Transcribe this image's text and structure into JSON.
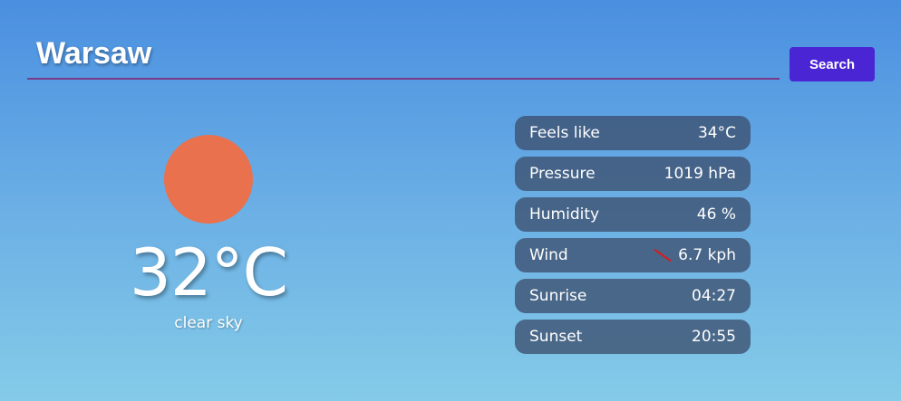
{
  "search": {
    "value": "Warsaw",
    "button_label": "Search"
  },
  "current": {
    "temperature": "32°C",
    "description": "clear sky",
    "icon": "sun-icon",
    "icon_color": "#ea714d"
  },
  "details": {
    "feels_like": {
      "label": "Feels like",
      "value": "34°C"
    },
    "pressure": {
      "label": "Pressure",
      "value": "1019 hPa"
    },
    "humidity": {
      "label": "Humidity",
      "value": "46 %"
    },
    "wind": {
      "label": "Wind",
      "value": "6.7 kph",
      "icon": "wind-direction-arrow-icon",
      "icon_color": "#e01818"
    },
    "sunrise": {
      "label": "Sunrise",
      "value": "04:27"
    },
    "sunset": {
      "label": "Sunset",
      "value": "20:55"
    }
  },
  "colors": {
    "accent": "#4a25d4",
    "underline": "#7a3a8a",
    "panel": "#3c506e"
  }
}
